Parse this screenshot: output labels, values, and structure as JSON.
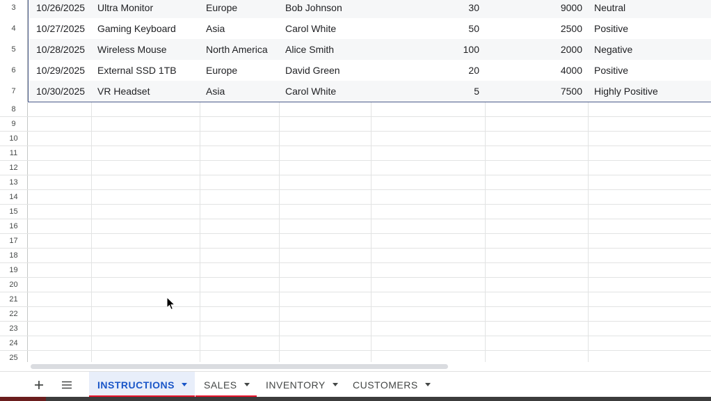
{
  "table": {
    "rows": [
      {
        "num": "3",
        "date": "10/26/2025",
        "product": "Ultra Monitor",
        "region": "Europe",
        "rep": "Bob Johnson",
        "qty": "30",
        "amount": "9000",
        "sentiment": "Neutral"
      },
      {
        "num": "4",
        "date": "10/27/2025",
        "product": "Gaming Keyboard",
        "region": "Asia",
        "rep": "Carol White",
        "qty": "50",
        "amount": "2500",
        "sentiment": "Positive"
      },
      {
        "num": "5",
        "date": "10/28/2025",
        "product": "Wireless Mouse",
        "region": "North America",
        "rep": "Alice Smith",
        "qty": "100",
        "amount": "2000",
        "sentiment": "Negative"
      },
      {
        "num": "6",
        "date": "10/29/2025",
        "product": "External SSD 1TB",
        "region": "Europe",
        "rep": "David Green",
        "qty": "20",
        "amount": "4000",
        "sentiment": "Positive"
      },
      {
        "num": "7",
        "date": "10/30/2025",
        "product": "VR Headset",
        "region": "Asia",
        "rep": "Carol White",
        "qty": "5",
        "amount": "7500",
        "sentiment": "Highly Positive"
      }
    ],
    "empty_rows": [
      "8",
      "9",
      "10",
      "11",
      "12",
      "13",
      "14",
      "15",
      "16",
      "17",
      "18",
      "19",
      "20",
      "21",
      "22",
      "23",
      "24",
      "25"
    ]
  },
  "sheet_tabs": [
    {
      "label": "INSTRUCTIONS",
      "active": true
    },
    {
      "label": "SALES",
      "active": false
    },
    {
      "label": "INVENTORY",
      "active": false
    },
    {
      "label": "CUSTOMERS",
      "active": false
    }
  ],
  "toolbar": {
    "add_sheet_icon": "plus-icon",
    "all_sheets_icon": "menu-icon"
  },
  "colors": {
    "active_tab_text": "#1a56c8",
    "active_tab_bg": "#e8eefa",
    "tab_underline": "#e8132b",
    "table_border": "#4a5a8a"
  }
}
